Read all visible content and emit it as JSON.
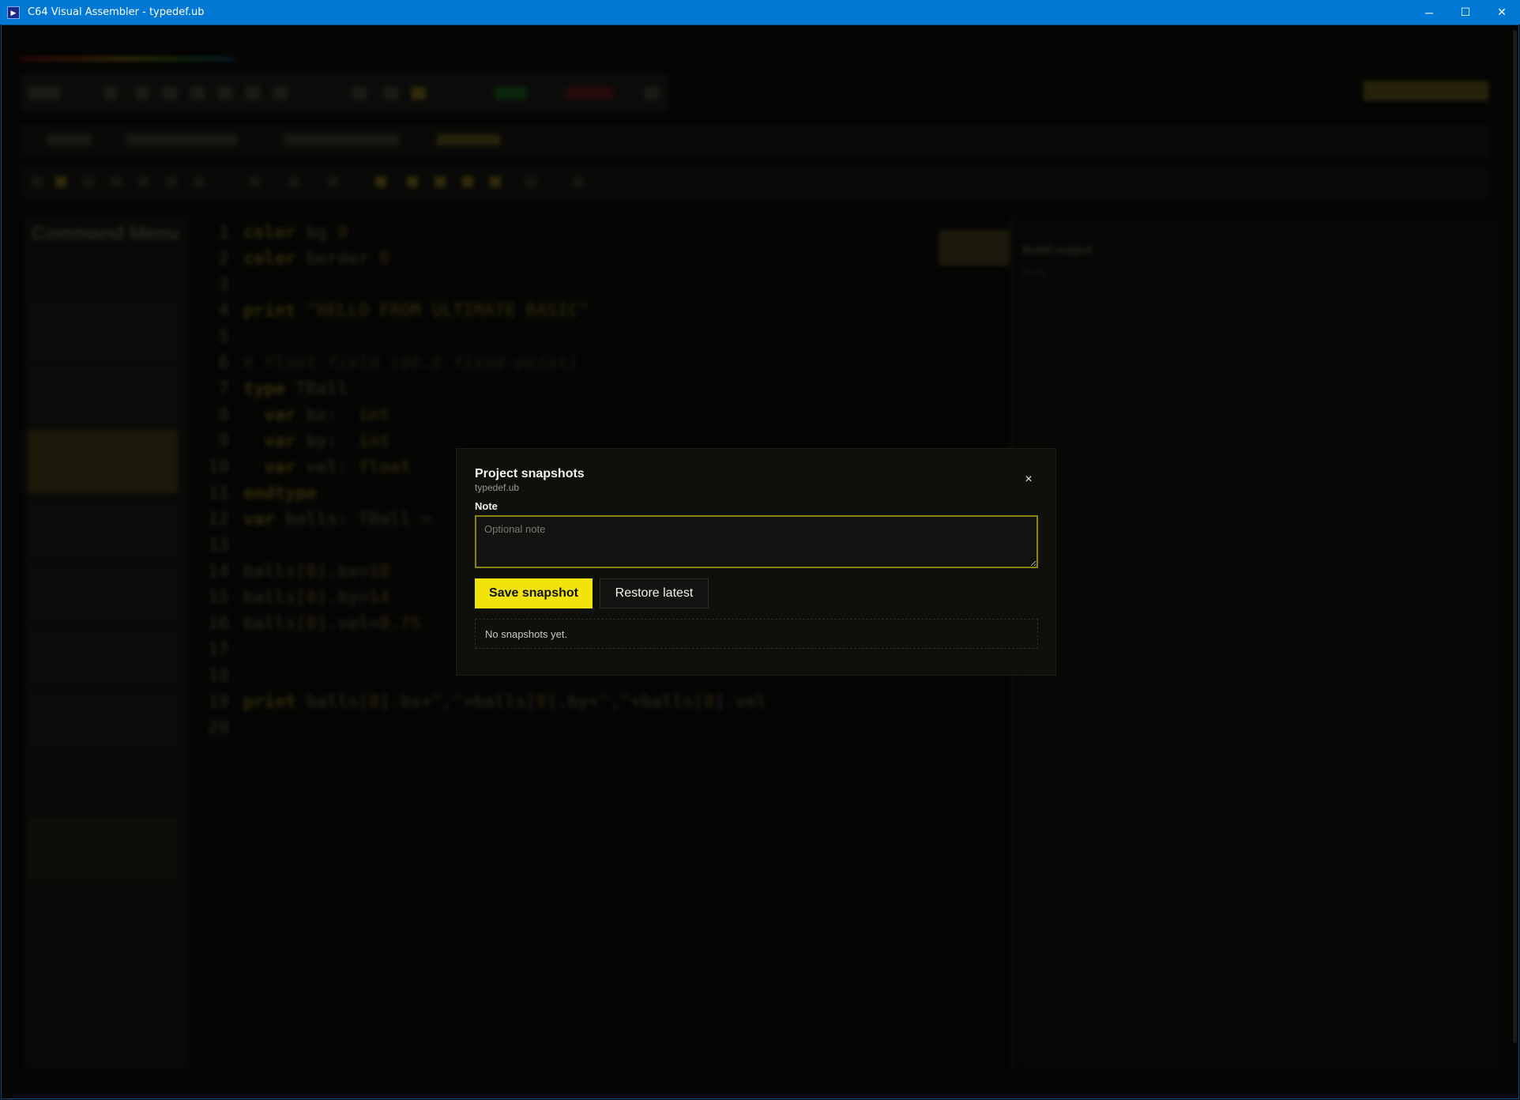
{
  "window": {
    "title": "C64 Visual Assembler - typedef.ub",
    "icon": "app-icon",
    "controls": {
      "minimize": "─",
      "maximize": "☐",
      "close": "✕"
    }
  },
  "background": {
    "command_menu_title": "Command Menu",
    "build_output_title": "Build output",
    "build_output_status": "Ready",
    "accent_color": "#f2e40a",
    "code_lines": [
      {
        "n": "1"
      },
      {
        "n": "2"
      },
      {
        "n": "3"
      },
      {
        "n": "4"
      },
      {
        "n": "5"
      },
      {
        "n": "6"
      },
      {
        "n": "7"
      },
      {
        "n": "8"
      },
      {
        "n": "9"
      },
      {
        "n": "10"
      },
      {
        "n": "11"
      },
      {
        "n": "12"
      },
      {
        "n": "13"
      },
      {
        "n": "14"
      },
      {
        "n": "15"
      },
      {
        "n": "16"
      },
      {
        "n": "17"
      },
      {
        "n": "18"
      },
      {
        "n": "19"
      },
      {
        "n": "20"
      }
    ],
    "code": {
      "l1": [
        "color",
        " bg ",
        "0"
      ],
      "l2": [
        "color",
        " border ",
        "0"
      ],
      "l4": [
        "print",
        " ",
        "\"HELLO FROM ULTIMATE BASIC\""
      ],
      "l6": "# Float field (Q8.8 fixed-point)",
      "l7": [
        "type",
        " TBall"
      ],
      "l8": [
        "  var",
        " bx:  ",
        "int"
      ],
      "l9": [
        "  var",
        " by:  ",
        "int"
      ],
      "l10": [
        "  var",
        " vel: ",
        "float"
      ],
      "l11": "endtype",
      "l12": [
        "var",
        " balls: TBall = "
      ],
      "l14": [
        "balls[",
        "0",
        "].bx=",
        "10"
      ],
      "l15": [
        "balls[",
        "0",
        "].by=",
        "14"
      ],
      "l16": [
        "balls[",
        "0",
        "].vel=",
        "0.75"
      ],
      "l19": [
        "print",
        " balls[",
        "0",
        "].bx+\",\"+balls[",
        "0",
        "].by+\",\"+balls[",
        "0",
        "].vel"
      ]
    }
  },
  "modal": {
    "title": "Project snapshots",
    "subtitle": "typedef.ub",
    "close_icon": "×",
    "note_label": "Note",
    "note_placeholder": "Optional note",
    "note_value": "",
    "save_button": "Save snapshot",
    "restore_button": "Restore latest",
    "empty_message": "No snapshots yet."
  }
}
